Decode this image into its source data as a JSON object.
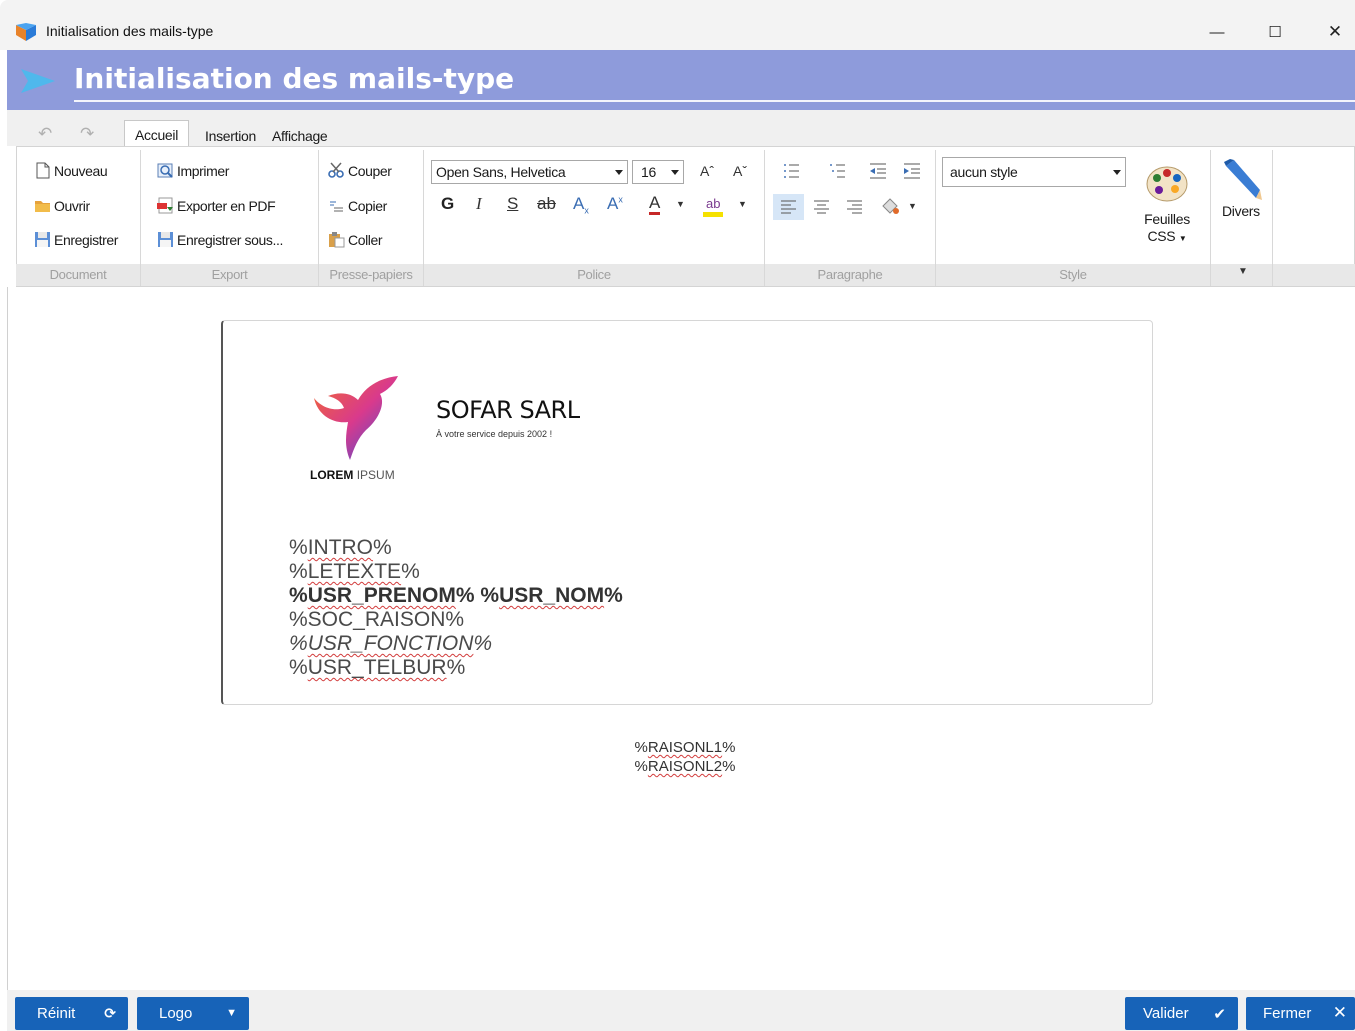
{
  "window": {
    "title": "Initialisation des mails-type",
    "minimize_glyph": "—",
    "maximize_glyph": "☐",
    "close_glyph": "✕"
  },
  "header": {
    "title": "Initialisation des mails-type",
    "color": "#8e9bdb"
  },
  "ribbon": {
    "tabs": [
      "Accueil",
      "Insertion",
      "Affichage"
    ],
    "active_tab": "Accueil",
    "groups": {
      "document": {
        "label": "Document",
        "buttons": [
          "Nouveau",
          "Ouvrir",
          "Enregistrer"
        ]
      },
      "export": {
        "label": "Export",
        "buttons": [
          "Imprimer",
          "Exporter en PDF",
          "Enregistrer sous..."
        ]
      },
      "clipboard": {
        "label": "Presse-papiers",
        "buttons": [
          "Couper",
          "Copier",
          "Coller"
        ]
      },
      "font": {
        "label": "Police",
        "font_family": "Open Sans, Helvetica",
        "font_size": "16",
        "bold_glyph": "G",
        "italic_glyph": "I",
        "underline_glyph": "S",
        "strike_glyph": "ab"
      },
      "paragraph": {
        "label": "Paragraphe"
      },
      "style": {
        "label": "Style",
        "selected_style": "aucun style",
        "css_button": "Feuilles",
        "css_button_line2": "CSS"
      },
      "misc": {
        "label": "Divers"
      }
    }
  },
  "document": {
    "company": "SOFAR SARL",
    "slogan": "À votre service depuis 2002 !",
    "logo_text_bold": "LOREM",
    "logo_text": "IPSUM",
    "fields": {
      "intro": "%INTRO%",
      "letexte": "%LETEXTE%",
      "usr_prenom": "%USR_PRENOM%",
      "usr_nom": "%USR_NOM%",
      "soc_raison": "%SOC_RAISON%",
      "usr_fonction": "%USR_FONCTION%",
      "usr_telbur": "%USR_TELBUR%"
    },
    "footer": {
      "line1": "%RAISONL1%",
      "line2": "%RAISONL2%"
    }
  },
  "bottom": {
    "reinit": "Réinit",
    "logo": "Logo",
    "valider": "Valider",
    "fermer": "Fermer",
    "button_color": "#1763b8"
  }
}
